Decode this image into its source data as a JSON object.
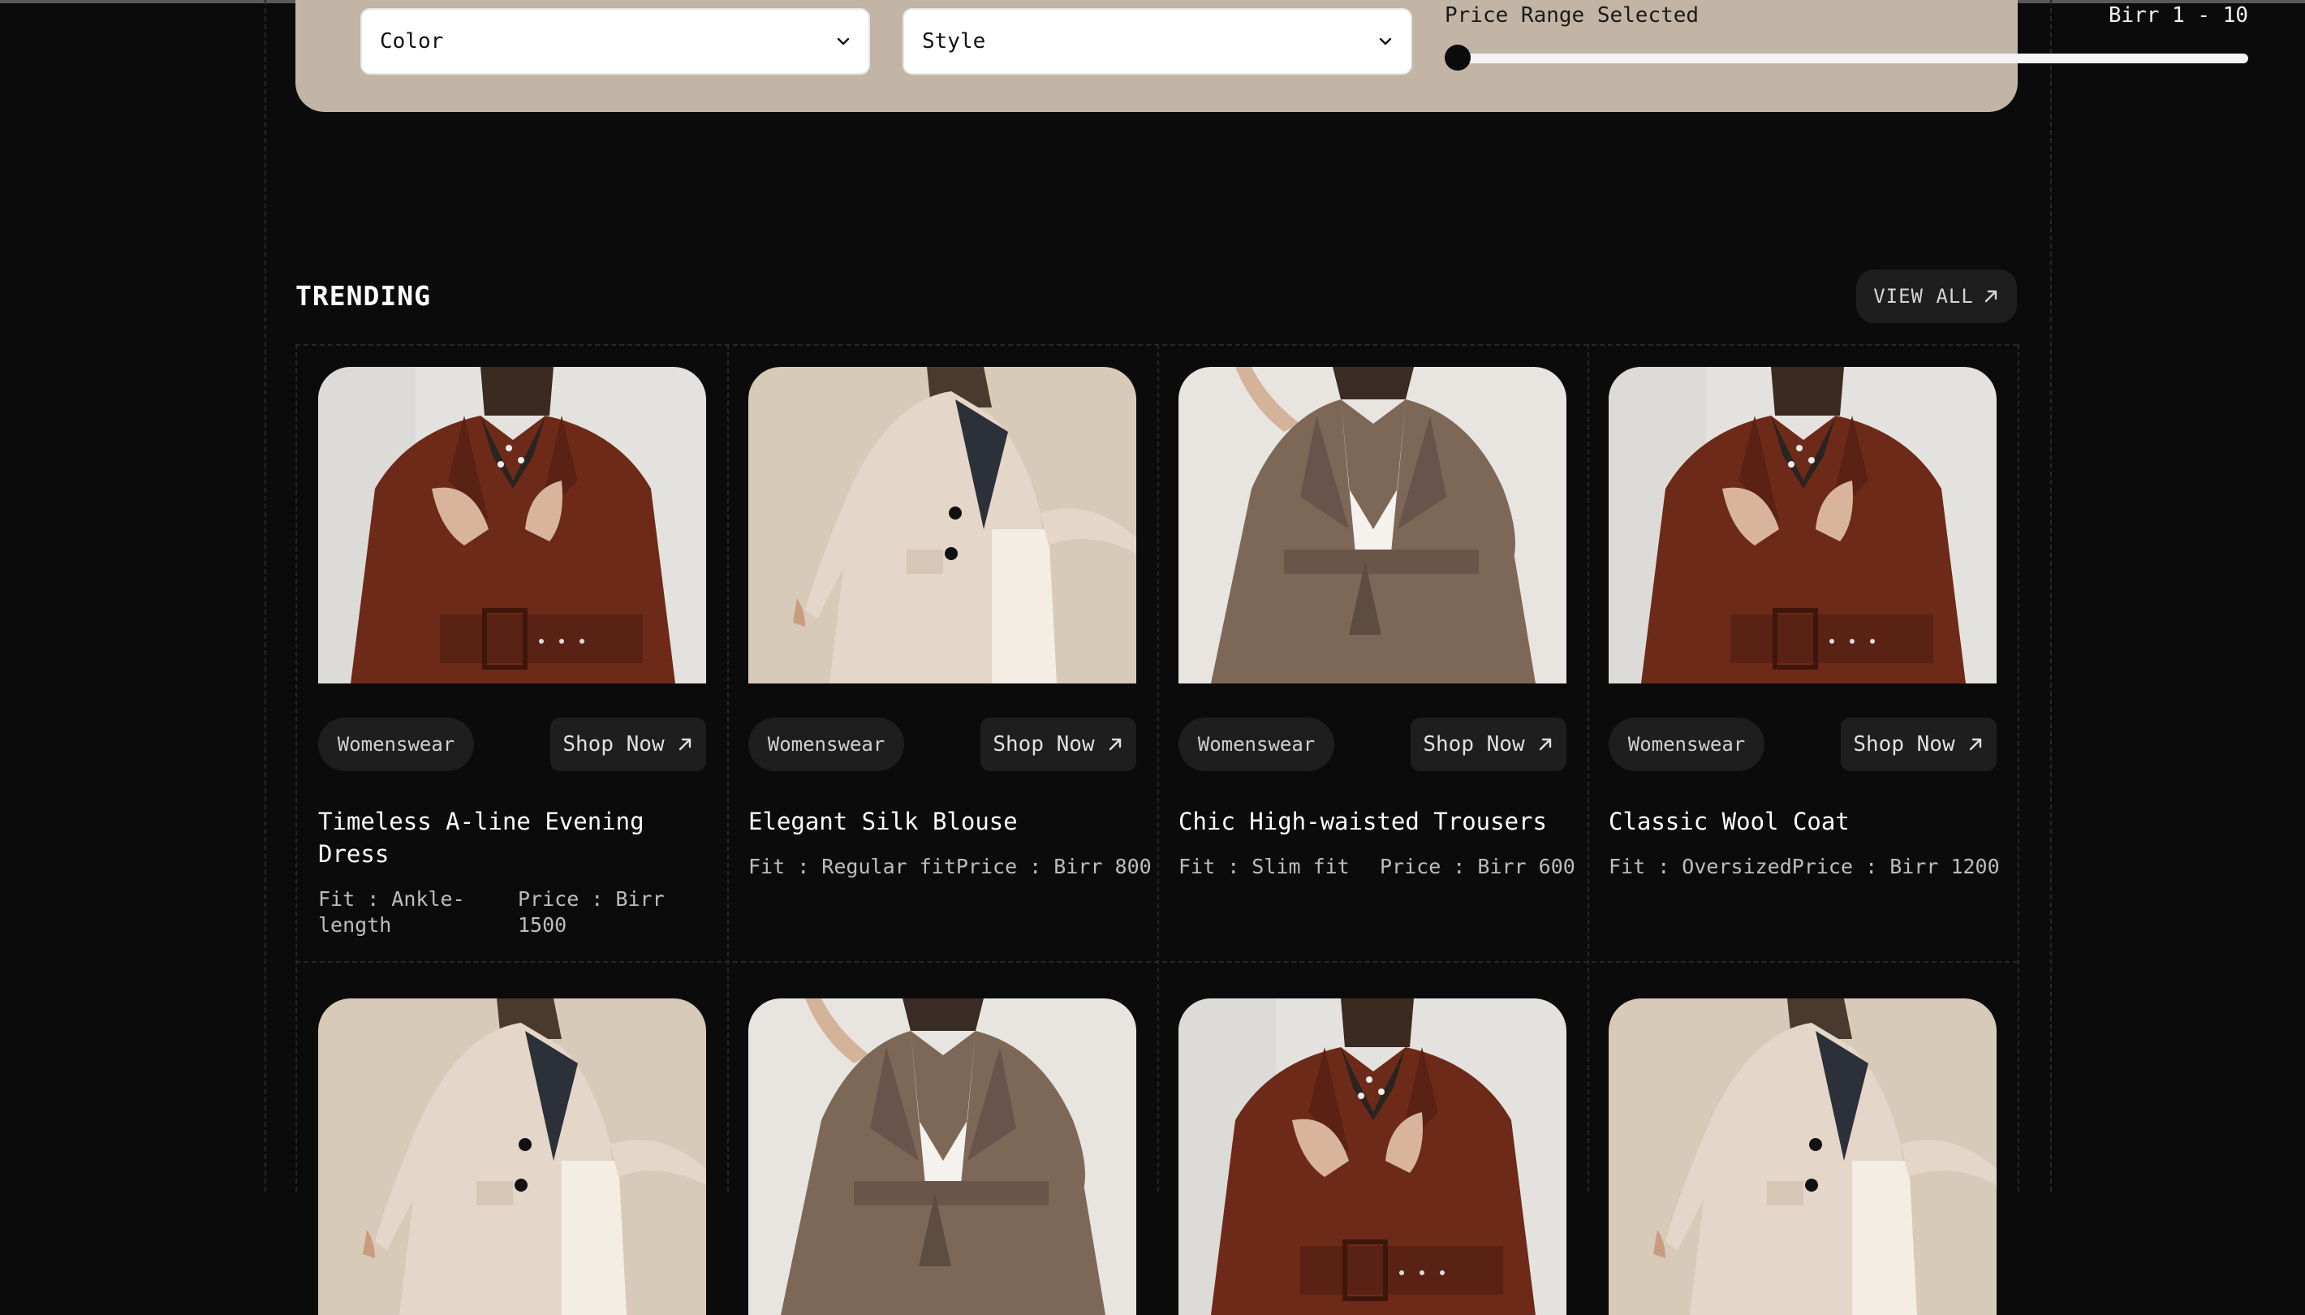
{
  "filters": {
    "color_label": "Color",
    "style_label": "Style",
    "price_range_label": "Price Range Selected",
    "price_range_value": "Birr 1 - 10",
    "slider_position": 0
  },
  "trending": {
    "title": "TRENDING",
    "view_all_label": "VIEW ALL"
  },
  "products": [
    {
      "tag": "Womenswear",
      "shop_label": "Shop Now",
      "name": "Timeless A-line Evening Dress",
      "fit": "Fit : Ankle-length",
      "price": "Price : Birr 1500",
      "image": "rust-coat"
    },
    {
      "tag": "Womenswear",
      "shop_label": "Shop Now",
      "name": "Elegant Silk Blouse",
      "fit": "Fit : Regular fit",
      "price": "Price : Birr 800",
      "image": "beige-blazer"
    },
    {
      "tag": "Womenswear",
      "shop_label": "Shop Now",
      "name": "Chic High-waisted Trousers",
      "fit": "Fit : Slim fit",
      "price": "Price : Birr 600",
      "image": "taupe-leather-coat"
    },
    {
      "tag": "Womenswear",
      "shop_label": "Shop Now",
      "name": "Classic Wool Coat",
      "fit": "Fit : Oversized",
      "price": "Price : Birr 1200",
      "image": "rust-coat"
    }
  ],
  "second_row_images": [
    "beige-blazer",
    "taupe-leather-coat",
    "rust-coat",
    "beige-blazer"
  ],
  "colors": {
    "background": "#0b0b0b",
    "filter_panel": "#c3b5a5",
    "chip": "#1e1e1e",
    "rust": "#6e2a18",
    "beige": "#d8c8b8",
    "taupe": "#7d6858"
  }
}
